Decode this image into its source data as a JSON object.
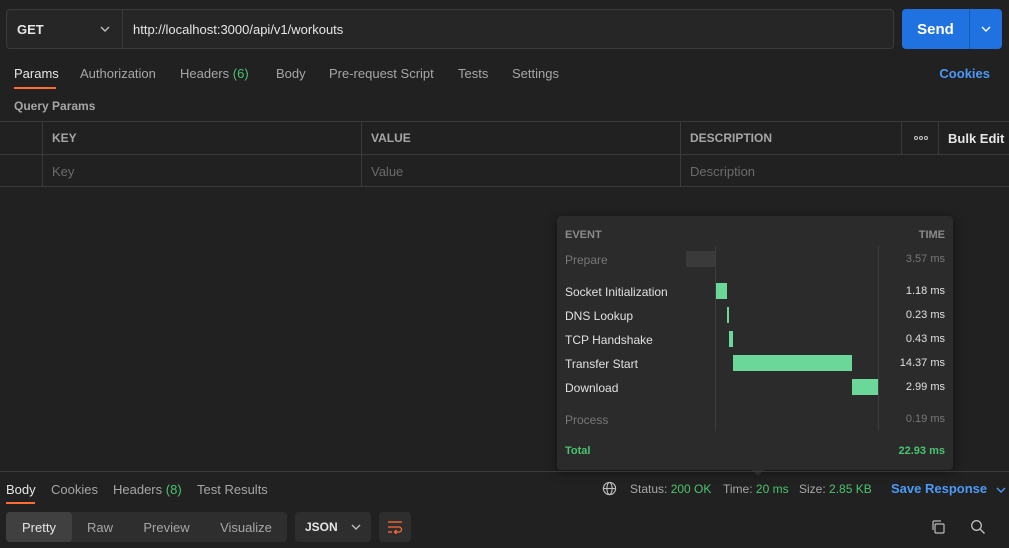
{
  "request": {
    "method": "GET",
    "url": "http://localhost:3000/api/v1/workouts",
    "send_label": "Send"
  },
  "request_tabs": [
    {
      "label": "Params",
      "active": true
    },
    {
      "label": "Authorization"
    },
    {
      "label": "Headers",
      "count": "(6)"
    },
    {
      "label": "Body"
    },
    {
      "label": "Pre-request Script"
    },
    {
      "label": "Tests"
    },
    {
      "label": "Settings"
    }
  ],
  "cookies_label": "Cookies",
  "query_params_label": "Query Params",
  "params_table": {
    "headers": {
      "key": "KEY",
      "value": "VALUE",
      "description": "DESCRIPTION",
      "more": "ooo",
      "bulk_edit": "Bulk Edit"
    },
    "placeholders": {
      "key": "Key",
      "value": "Value",
      "description": "Description"
    }
  },
  "timing": {
    "event_header": "EVENT",
    "time_header": "TIME",
    "events": [
      {
        "name": "Prepare",
        "time": "3.57 ms"
      },
      {
        "name": "Socket Initialization",
        "time": "1.18 ms"
      },
      {
        "name": "DNS Lookup",
        "time": "0.23 ms"
      },
      {
        "name": "TCP Handshake",
        "time": "0.43 ms"
      },
      {
        "name": "Transfer Start",
        "time": "14.37 ms"
      },
      {
        "name": "Download",
        "time": "2.99 ms"
      },
      {
        "name": "Process",
        "time": "0.19 ms"
      }
    ],
    "total_label": "Total",
    "total_time": "22.93 ms"
  },
  "response": {
    "tabs": [
      {
        "label": "Body",
        "active": true
      },
      {
        "label": "Cookies"
      },
      {
        "label": "Headers",
        "count": "(8)"
      },
      {
        "label": "Test Results"
      }
    ],
    "status_label": "Status:",
    "status_value": "200 OK",
    "time_label": "Time:",
    "time_value": "20 ms",
    "size_label": "Size:",
    "size_value": "2.85 KB",
    "save_label": "Save Response",
    "views": [
      "Pretty",
      "Raw",
      "Preview",
      "Visualize"
    ],
    "format": "JSON"
  },
  "colors": {
    "accent": "#ff6c37",
    "send": "#1f72df",
    "success": "#49c46e",
    "link": "#4b9af7"
  }
}
